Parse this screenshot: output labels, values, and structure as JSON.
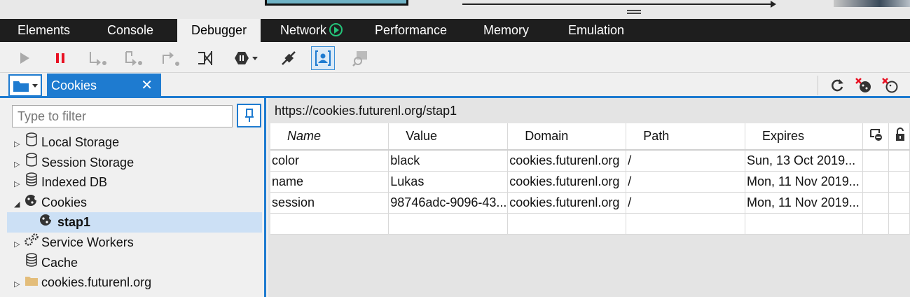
{
  "tabs": [
    {
      "label": "Elements"
    },
    {
      "label": "Console"
    },
    {
      "label": "Debugger"
    },
    {
      "label": "Network"
    },
    {
      "label": "Performance"
    },
    {
      "label": "Memory"
    },
    {
      "label": "Emulation"
    }
  ],
  "active_tab": "Debugger",
  "file_tab": {
    "label": "Cookies",
    "close": "✕"
  },
  "filter": {
    "placeholder": "Type to filter"
  },
  "tree": [
    {
      "label": "Local Storage",
      "icon": "database-icon"
    },
    {
      "label": "Session Storage",
      "icon": "database-icon"
    },
    {
      "label": "Indexed DB",
      "icon": "database-stack-icon"
    },
    {
      "label": "Cookies",
      "icon": "cookie-icon"
    },
    {
      "label": "stap1",
      "icon": "cookie-icon"
    },
    {
      "label": "Service Workers",
      "icon": "gears-icon"
    },
    {
      "label": "Cache",
      "icon": "database-stack-icon"
    },
    {
      "label": "cookies.futurenl.org",
      "icon": "folder-icon"
    }
  ],
  "main": {
    "url": "https://cookies.futurenl.org/stap1",
    "columns": [
      "Name",
      "Value",
      "Domain",
      "Path",
      "Expires"
    ],
    "rows": [
      {
        "name": "color",
        "value": "black",
        "domain": "cookies.futurenl.org",
        "path": "/",
        "expires": "Sun, 13 Oct 2019..."
      },
      {
        "name": "name",
        "value": "Lukas",
        "domain": "cookies.futurenl.org",
        "path": "/",
        "expires": "Mon, 11 Nov 2019..."
      },
      {
        "name": "session",
        "value": "98746adc-9096-43...",
        "domain": "cookies.futurenl.org",
        "path": "/",
        "expires": "Mon, 11 Nov 2019..."
      }
    ]
  },
  "colors": {
    "accent": "#1e7bd0",
    "tabbar": "#1e1e1e",
    "pause": "#e81123",
    "network_play": "#24c47a"
  }
}
